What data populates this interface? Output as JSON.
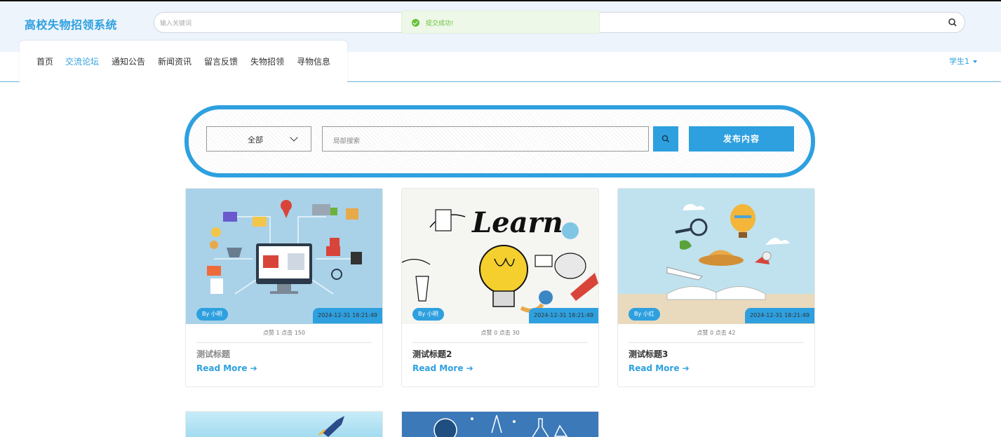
{
  "header": {
    "site_title": "高校失物招领系统",
    "search_placeholder": "输入关键词"
  },
  "toast": {
    "message": "提交成功!",
    "color": "#67c23a"
  },
  "nav": {
    "items": [
      {
        "label": "首页",
        "active": false
      },
      {
        "label": "交流论坛",
        "active": true
      },
      {
        "label": "通知公告",
        "active": false
      },
      {
        "label": "新闻资讯",
        "active": false
      },
      {
        "label": "留言反馈",
        "active": false
      },
      {
        "label": "失物招领",
        "active": false
      },
      {
        "label": "寻物信息",
        "active": false
      }
    ],
    "user": "学生1"
  },
  "filter": {
    "select_value": "全部",
    "local_search_placeholder": "局部搜索",
    "publish_label": "发布内容"
  },
  "cards": [
    {
      "author": "By 小明",
      "date": "2024-12-31 18:21:49",
      "stats": "点赞 1 点击 150",
      "title": "测试标题",
      "more": "Read More ➔"
    },
    {
      "author": "By 小明",
      "date": "2024-12-31 18:21:49",
      "stats": "点赞 0 点击 30",
      "title": "测试标题2",
      "more": "Read More ➔"
    },
    {
      "author": "By 小红",
      "date": "2024-12-31 18:21:49",
      "stats": "点赞 0 点击 42",
      "title": "测试标题3",
      "more": "Read More ➔"
    }
  ],
  "thumb_2_text": "Learn",
  "colors": {
    "accent": "#2ea0df",
    "header_bg": "#edf4fc"
  }
}
